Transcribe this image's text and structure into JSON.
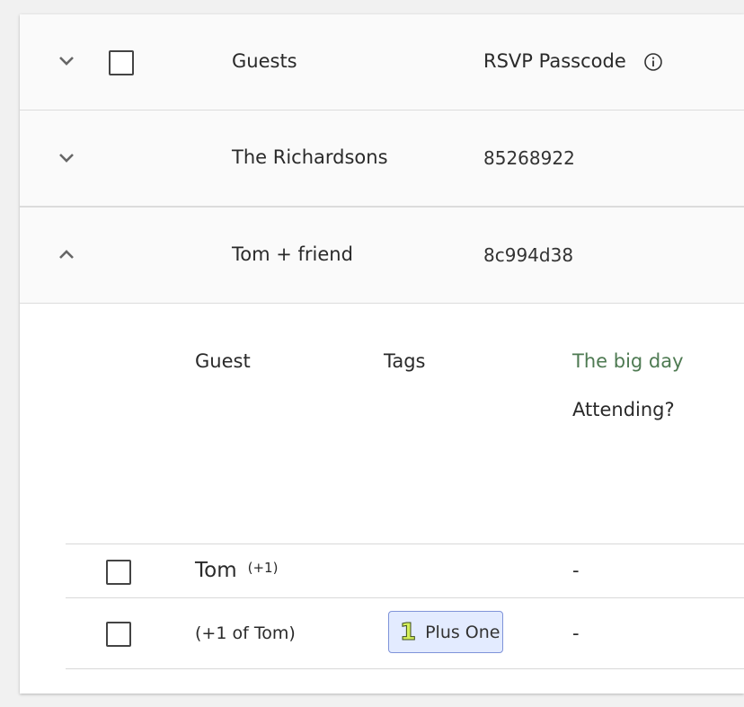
{
  "table": {
    "columns": {
      "guests": "Guests",
      "rsvp_passcode": "RSVP Passcode"
    },
    "groups": [
      {
        "name": "The Richardsons",
        "passcode": "85268922",
        "expanded": false
      },
      {
        "name": "Tom + friend",
        "passcode": "8c994d38",
        "expanded": true
      }
    ]
  },
  "detail": {
    "columns": {
      "guest": "Guest",
      "tags": "Tags",
      "event_name": "The big day",
      "event_question": "Attending?"
    },
    "rows": [
      {
        "guest": "Tom",
        "guest_suffix": "(+1)",
        "tag": "",
        "attending": "-"
      },
      {
        "guest": "(+1 of Tom)",
        "tag_icon": "1",
        "tag": "Plus One",
        "attending": "-"
      }
    ]
  },
  "icons": {
    "expand": "chevron-down-icon",
    "collapse": "chevron-up-icon",
    "info": "info-circle-icon",
    "tag": "plus-one-icon"
  },
  "colors": {
    "event_accent": "#4e7a52",
    "tag_background": "#e3ebff",
    "tag_border": "#7f93d9"
  }
}
